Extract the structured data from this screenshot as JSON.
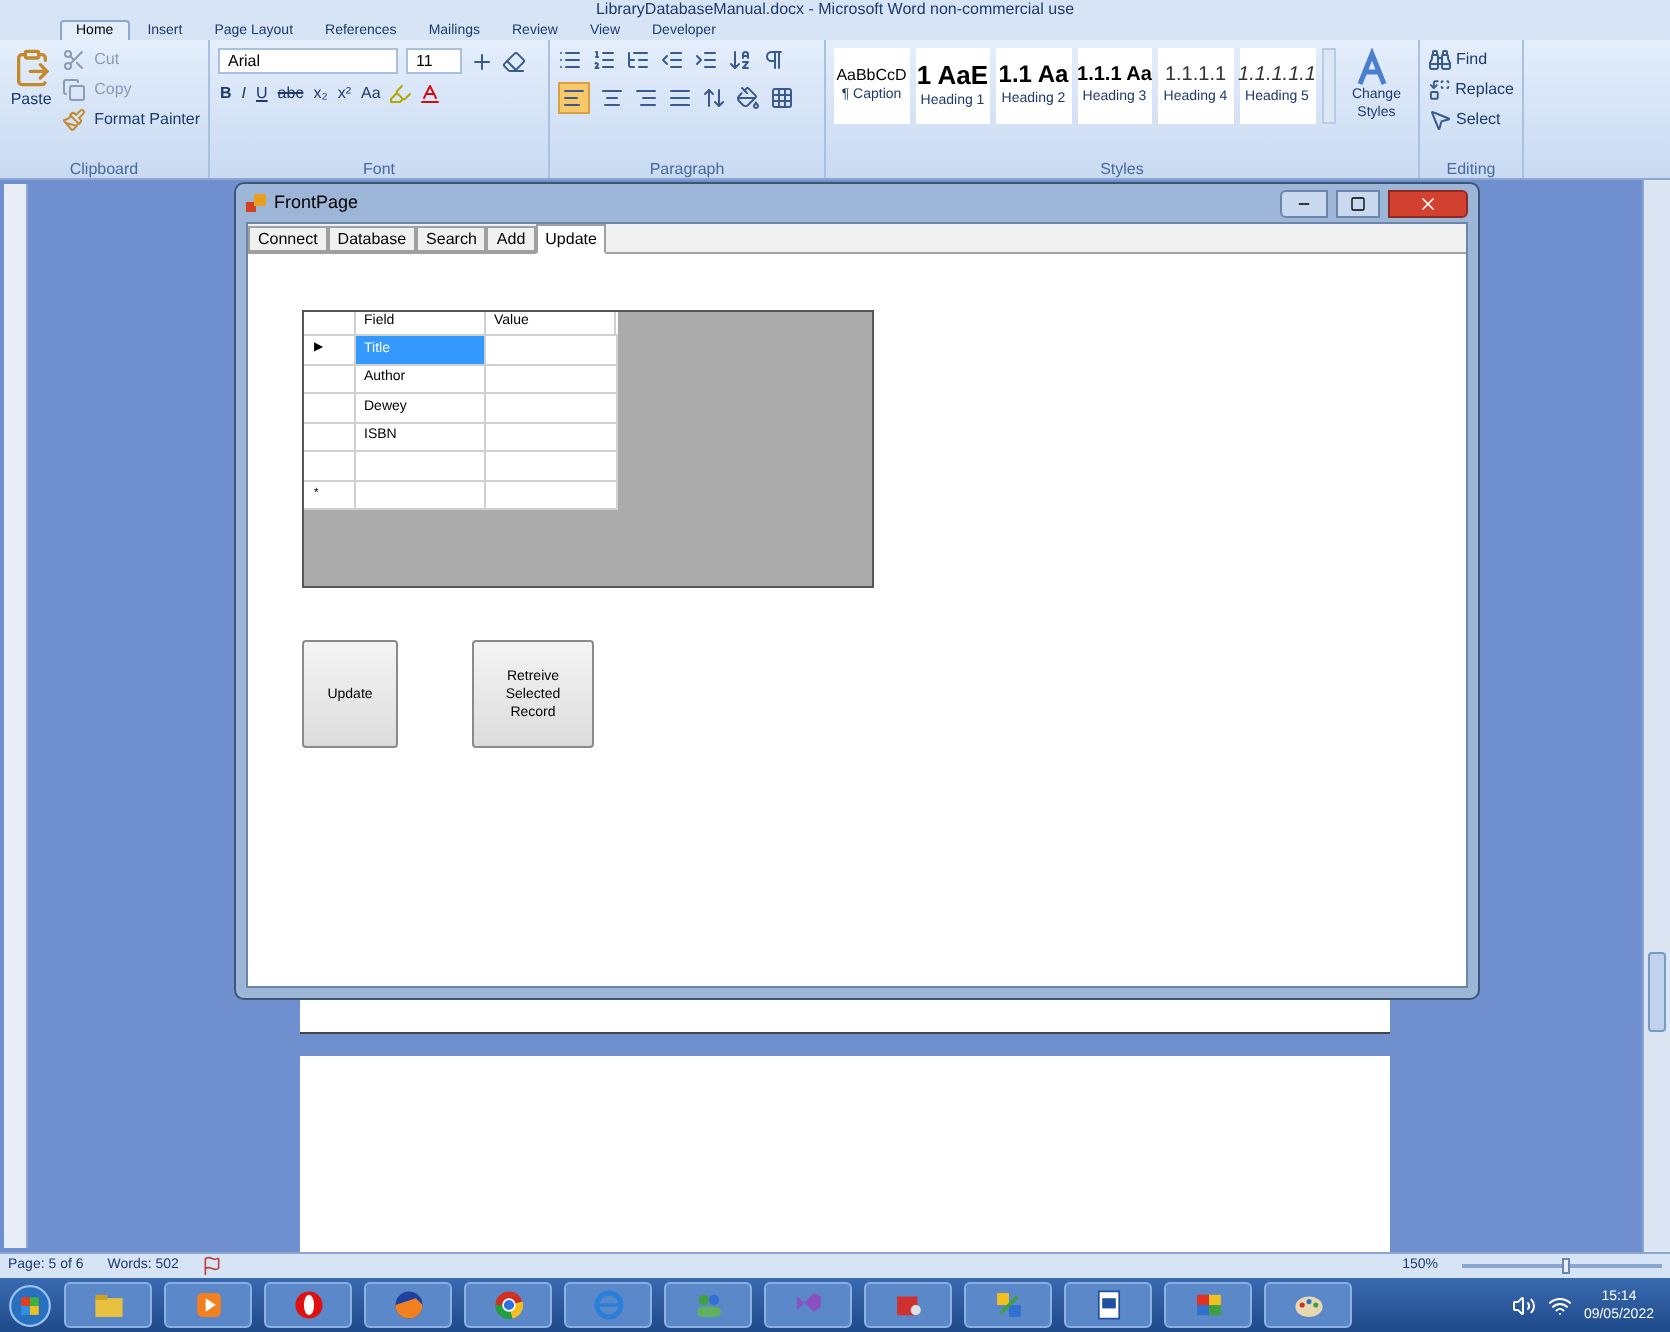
{
  "window": {
    "title": "LibraryDatabaseManual.docx - Microsoft Word non-commercial use"
  },
  "ribbon_tabs": [
    {
      "label": "Home",
      "selected": true
    },
    {
      "label": "Insert",
      "selected": false
    },
    {
      "label": "Page Layout",
      "selected": false
    },
    {
      "label": "References",
      "selected": false
    },
    {
      "label": "Mailings",
      "selected": false
    },
    {
      "label": "Review",
      "selected": false
    },
    {
      "label": "View",
      "selected": false
    },
    {
      "label": "Developer",
      "selected": false
    }
  ],
  "clipboard": {
    "paste": "Paste",
    "cut": "Cut",
    "copy": "Copy",
    "format_painter": "Format Painter",
    "label": "Clipboard"
  },
  "font": {
    "name": "Arial",
    "size": "11",
    "format_buttons": [
      "B",
      "I",
      "U",
      "abc",
      "x₂",
      "x²",
      "Aa"
    ],
    "label": "Font"
  },
  "paragraph": {
    "label": "Paragraph"
  },
  "styles": {
    "items": [
      {
        "preview": "AaBbCcD",
        "name": "¶ Caption"
      },
      {
        "preview": "1 AaE",
        "name": "Heading 1"
      },
      {
        "preview": "1.1 Aa",
        "name": "Heading 2"
      },
      {
        "preview": "1.1.1 Aa",
        "name": "Heading 3"
      },
      {
        "preview": "1.1.1.1",
        "name": "Heading 4"
      },
      {
        "preview": "1.1.1.1.1",
        "name": "Heading 5"
      }
    ],
    "change_styles": "Change Styles",
    "label": "Styles"
  },
  "editing": {
    "find": "Find",
    "replace": "Replace",
    "select": "Select",
    "label": "Editing"
  },
  "dialog": {
    "title": "FrontPage",
    "tabs": [
      {
        "label": "Connect",
        "selected": false
      },
      {
        "label": "Database",
        "selected": false
      },
      {
        "label": "Search",
        "selected": false
      },
      {
        "label": "Add",
        "selected": false
      },
      {
        "label": "Update",
        "selected": true
      }
    ],
    "grid": {
      "columns": [
        "Field",
        "Value"
      ],
      "rows": [
        {
          "indicator": "▶",
          "field": "Title",
          "selected": true
        },
        {
          "field": "Author",
          "selected": false
        },
        {
          "field": "Dewey",
          "selected": false
        },
        {
          "field": "ISBN",
          "selected": false
        },
        {
          "selected": false
        },
        {
          "indicator": "*",
          "selected": false
        }
      ]
    },
    "buttons": [
      "Update",
      "Retreive Selected Record"
    ]
  },
  "status_bar": {
    "page": "Page: 5 of 6",
    "words": "Words: 502",
    "zoom": "150%",
    "zoom_slider": {
      "level": 0.5
    }
  },
  "taskbar": {
    "time": "15:14",
    "date": "09/05/2022"
  }
}
